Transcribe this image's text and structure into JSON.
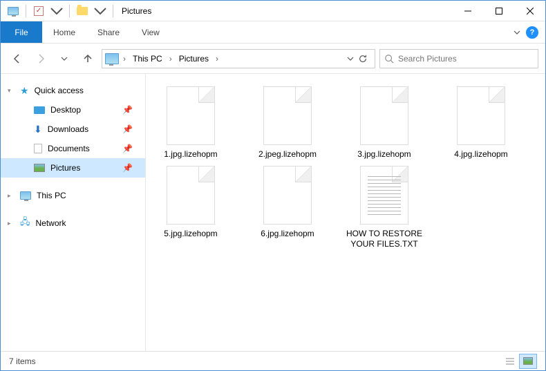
{
  "titlebar": {
    "title": "Pictures"
  },
  "ribbon": {
    "file": "File",
    "tabs": [
      "Home",
      "Share",
      "View"
    ]
  },
  "breadcrumb": {
    "segments": [
      "This PC",
      "Pictures"
    ]
  },
  "search": {
    "placeholder": "Search Pictures"
  },
  "sidebar": {
    "quick_access": "Quick access",
    "items": [
      {
        "label": "Desktop",
        "pinned": true
      },
      {
        "label": "Downloads",
        "pinned": true
      },
      {
        "label": "Documents",
        "pinned": true
      },
      {
        "label": "Pictures",
        "pinned": true,
        "selected": true
      }
    ],
    "this_pc": "This PC",
    "network": "Network"
  },
  "files": [
    {
      "name": "1.jpg.lizehopm",
      "type": "blank"
    },
    {
      "name": "2.jpeg.lizehopm",
      "type": "blank"
    },
    {
      "name": "3.jpg.lizehopm",
      "type": "blank"
    },
    {
      "name": "4.jpg.lizehopm",
      "type": "blank"
    },
    {
      "name": "5.jpg.lizehopm",
      "type": "blank"
    },
    {
      "name": "6.jpg.lizehopm",
      "type": "blank"
    },
    {
      "name": "HOW TO RESTORE YOUR FILES.TXT",
      "type": "txt"
    }
  ],
  "status": {
    "count": "7 items"
  }
}
